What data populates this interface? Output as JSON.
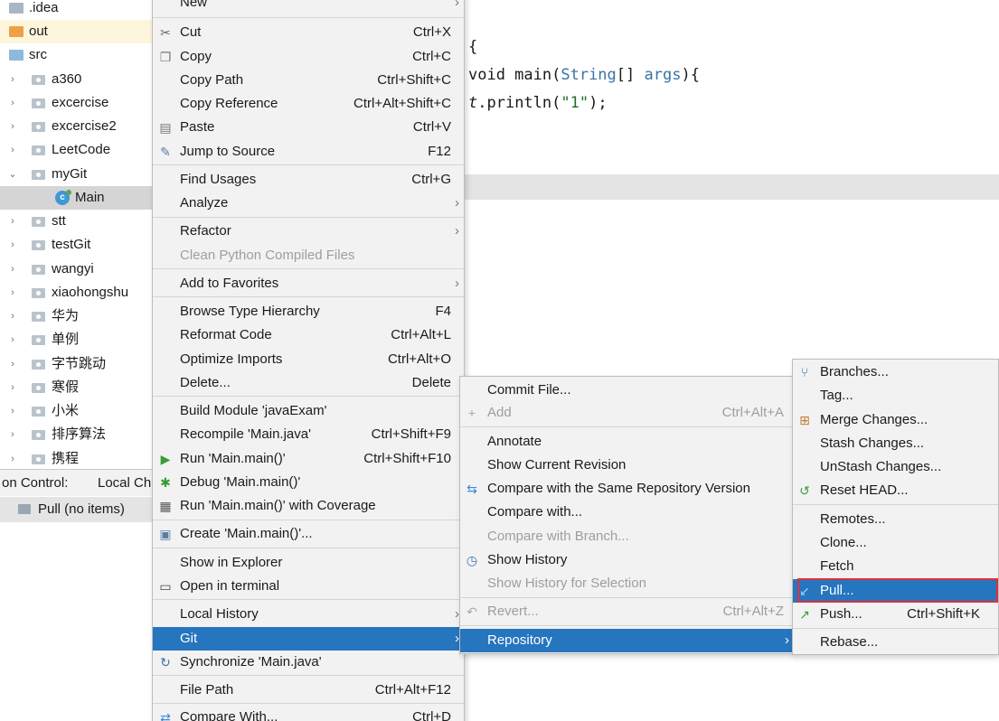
{
  "project_tree": {
    "items": [
      {
        "label": ".idea",
        "icon": "folder-icon",
        "expand": ""
      },
      {
        "label": "out",
        "icon": "folder-excluded-icon",
        "expand": ""
      },
      {
        "label": "src",
        "icon": "source-folder-icon",
        "expand": ""
      },
      {
        "label": "a360",
        "icon": "package-icon",
        "expand": "›"
      },
      {
        "label": "excercise",
        "icon": "package-icon",
        "expand": "›"
      },
      {
        "label": "excercise2",
        "icon": "package-icon",
        "expand": "›"
      },
      {
        "label": "LeetCode",
        "icon": "package-icon",
        "expand": "›"
      },
      {
        "label": "myGit",
        "icon": "package-icon",
        "expand": "⌄"
      },
      {
        "label": "Main",
        "icon": "java-class-icon",
        "expand": ""
      },
      {
        "label": "stt",
        "icon": "package-icon",
        "expand": "›"
      },
      {
        "label": "testGit",
        "icon": "package-icon",
        "expand": "›"
      },
      {
        "label": "wangyi",
        "icon": "package-icon",
        "expand": "›"
      },
      {
        "label": "xiaohongshu",
        "icon": "package-icon",
        "expand": "›"
      },
      {
        "label": "华为",
        "icon": "package-icon",
        "expand": "›"
      },
      {
        "label": "单例",
        "icon": "package-icon",
        "expand": "›"
      },
      {
        "label": "字节跳动",
        "icon": "package-icon",
        "expand": "›"
      },
      {
        "label": "寒假",
        "icon": "package-icon",
        "expand": "›"
      },
      {
        "label": "小米",
        "icon": "package-icon",
        "expand": "›"
      },
      {
        "label": "排序算法",
        "icon": "package-icon",
        "expand": "›"
      },
      {
        "label": "携程",
        "icon": "package-icon",
        "expand": "›"
      }
    ]
  },
  "version_control": {
    "title": "on Control:",
    "tab": "Local Ch",
    "pull_entry": "Pull (no items)"
  },
  "editor": {
    "line1": "{",
    "line2_a": "void main(",
    "line2_type": "String",
    "line2_b": "[] ",
    "line2_arg": "args",
    "line2_c": "){",
    "line3_it": "t",
    "line3_a": ".println(",
    "line3_str": "\"1\"",
    "line3_b": ");"
  },
  "context_menu": {
    "items": [
      {
        "label": "New",
        "shortcut": "",
        "submenu": "›"
      },
      {
        "label": "Cut",
        "shortcut": "Ctrl+X",
        "icon": "scissors-icon"
      },
      {
        "label": "Copy",
        "shortcut": "Ctrl+C",
        "icon": "copy-icon"
      },
      {
        "label": "Copy Path",
        "shortcut": "Ctrl+Shift+C"
      },
      {
        "label": "Copy Reference",
        "shortcut": "Ctrl+Alt+Shift+C"
      },
      {
        "label": "Paste",
        "shortcut": "Ctrl+V",
        "icon": "paste-icon"
      },
      {
        "label": "Jump to Source",
        "shortcut": "F12",
        "icon": "jump-icon"
      },
      {
        "label": "Find Usages",
        "shortcut": "Ctrl+G"
      },
      {
        "label": "Analyze",
        "shortcut": "",
        "submenu": "›"
      },
      {
        "label": "Refactor",
        "shortcut": "",
        "submenu": "›"
      },
      {
        "label": "Clean Python Compiled Files",
        "shortcut": "",
        "disabled": true
      },
      {
        "label": "Add to Favorites",
        "shortcut": "",
        "submenu": "›"
      },
      {
        "label": "Browse Type Hierarchy",
        "shortcut": "F4"
      },
      {
        "label": "Reformat Code",
        "shortcut": "Ctrl+Alt+L"
      },
      {
        "label": "Optimize Imports",
        "shortcut": "Ctrl+Alt+O"
      },
      {
        "label": "Delete...",
        "shortcut": "Delete"
      },
      {
        "label": "Build Module 'javaExam'",
        "shortcut": ""
      },
      {
        "label": "Recompile 'Main.java'",
        "shortcut": "Ctrl+Shift+F9"
      },
      {
        "label": "Run 'Main.main()'",
        "shortcut": "Ctrl+Shift+F10",
        "icon": "run-icon"
      },
      {
        "label": "Debug 'Main.main()'",
        "shortcut": "",
        "icon": "debug-icon"
      },
      {
        "label": "Run 'Main.main()' with Coverage",
        "shortcut": "",
        "icon": "coverage-icon"
      },
      {
        "label": "Create 'Main.main()'...",
        "shortcut": "",
        "icon": "create-config-icon"
      },
      {
        "label": "Show in Explorer",
        "shortcut": ""
      },
      {
        "label": "Open in terminal",
        "shortcut": "",
        "icon": "terminal-icon"
      },
      {
        "label": "Local History",
        "shortcut": "",
        "submenu": "›"
      },
      {
        "label": "Git",
        "shortcut": "",
        "submenu": "›",
        "active": true
      },
      {
        "label": "Synchronize 'Main.java'",
        "shortcut": "",
        "icon": "sync-icon"
      },
      {
        "label": "File Path",
        "shortcut": "Ctrl+Alt+F12"
      },
      {
        "label": "Compare With...",
        "shortcut": "Ctrl+D",
        "icon": "compare-icon"
      }
    ]
  },
  "git_menu": {
    "items": [
      {
        "label": "Commit File...",
        "shortcut": ""
      },
      {
        "label": "Add",
        "shortcut": "Ctrl+Alt+A",
        "disabled": true,
        "icon": "plus-icon"
      },
      {
        "label": "Annotate",
        "shortcut": ""
      },
      {
        "label": "Show Current Revision",
        "shortcut": ""
      },
      {
        "label": "Compare with the Same Repository Version",
        "shortcut": "",
        "icon": "compare-arrows-icon"
      },
      {
        "label": "Compare with...",
        "shortcut": ""
      },
      {
        "label": "Compare with Branch...",
        "shortcut": "",
        "disabled": true
      },
      {
        "label": "Show History",
        "shortcut": "",
        "icon": "history-icon"
      },
      {
        "label": "Show History for Selection",
        "shortcut": "",
        "disabled": true
      },
      {
        "label": "Revert...",
        "shortcut": "Ctrl+Alt+Z",
        "disabled": true,
        "icon": "revert-icon"
      },
      {
        "label": "Repository",
        "shortcut": "",
        "submenu": "›",
        "active": true
      }
    ]
  },
  "repository_menu": {
    "items": [
      {
        "label": "Branches...",
        "shortcut": "",
        "icon": "branches-icon"
      },
      {
        "label": "Tag...",
        "shortcut": ""
      },
      {
        "label": "Merge Changes...",
        "shortcut": "",
        "icon": "merge-icon"
      },
      {
        "label": "Stash Changes...",
        "shortcut": ""
      },
      {
        "label": "UnStash Changes...",
        "shortcut": ""
      },
      {
        "label": "Reset HEAD...",
        "shortcut": "",
        "icon": "reset-icon"
      },
      {
        "label": "Remotes...",
        "shortcut": ""
      },
      {
        "label": "Clone...",
        "shortcut": ""
      },
      {
        "label": "Fetch",
        "shortcut": ""
      },
      {
        "label": "Pull...",
        "shortcut": "",
        "icon": "pull-icon",
        "active": true
      },
      {
        "label": "Push...",
        "shortcut": "Ctrl+Shift+K",
        "icon": "push-icon"
      },
      {
        "label": "Rebase...",
        "shortcut": ""
      }
    ]
  },
  "colors": {
    "menu_bg": "#f2f2f2",
    "selection": "#2675bf",
    "highlight_outline": "#e0303a",
    "disabled_text": "#9e9e9e"
  }
}
